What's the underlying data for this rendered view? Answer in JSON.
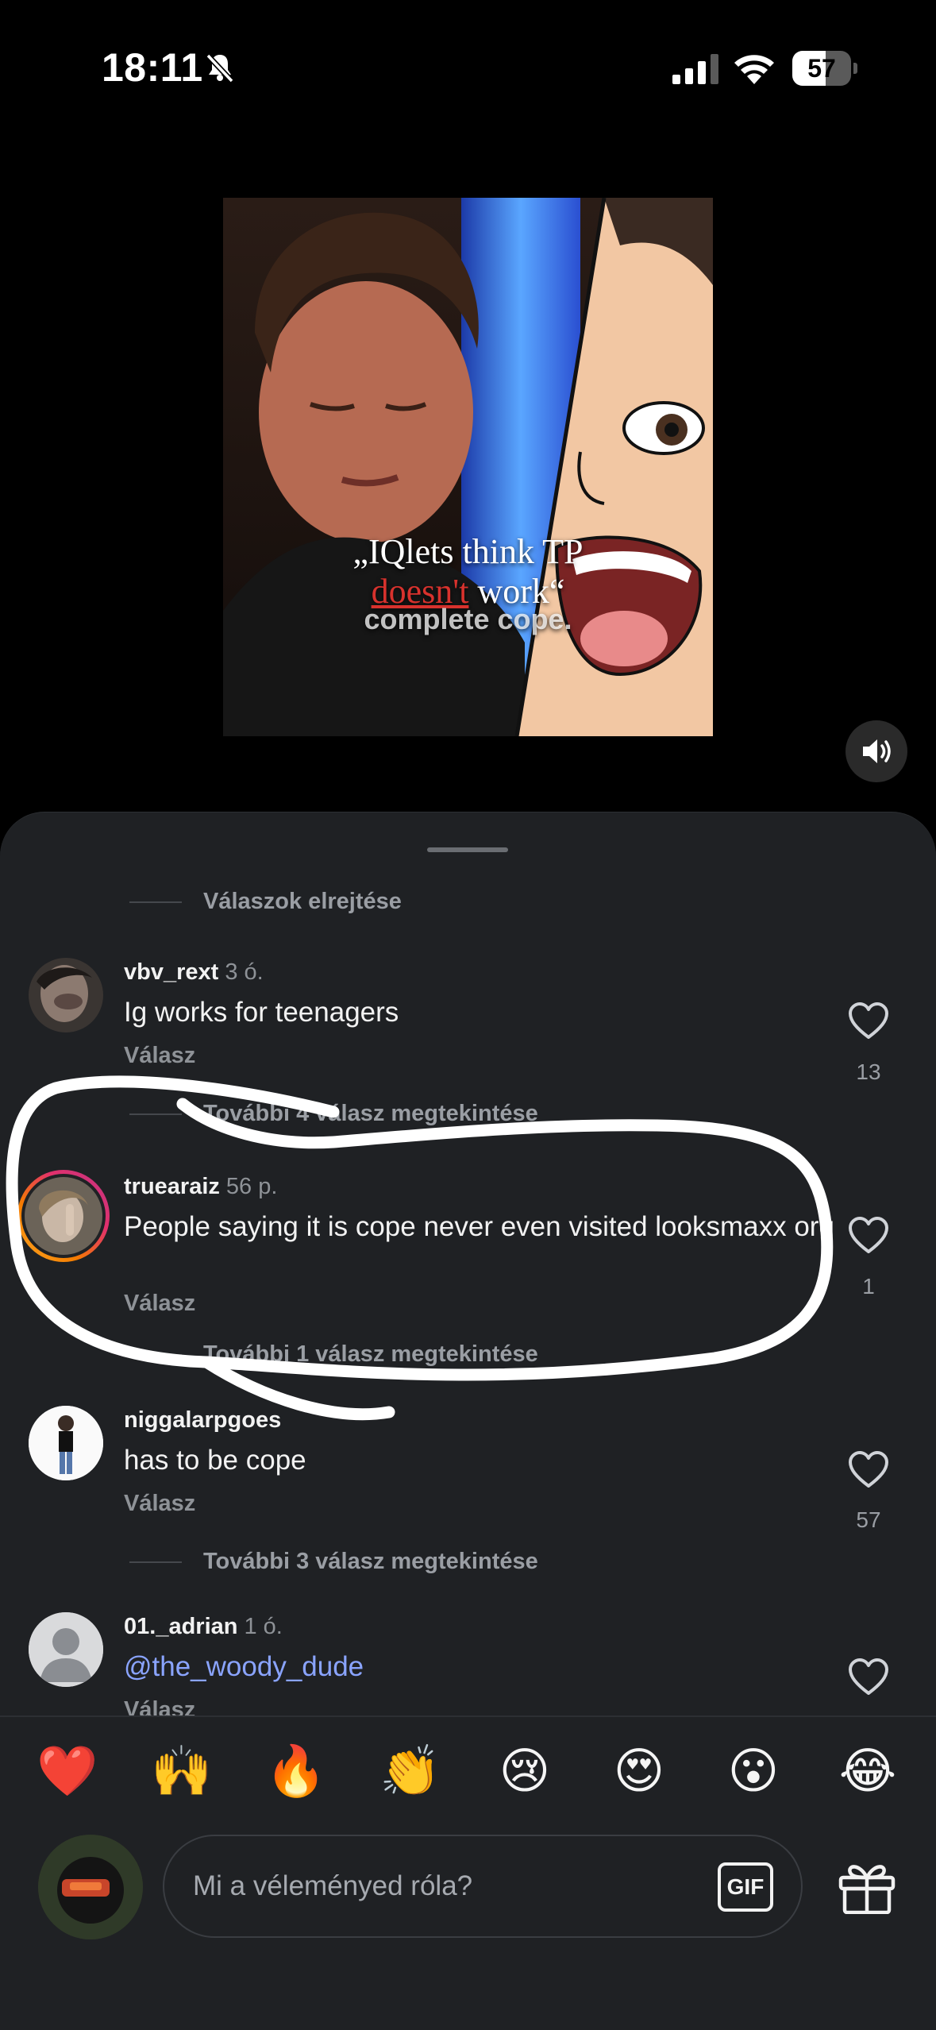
{
  "status_bar": {
    "time": "18:11",
    "battery": "57",
    "battery_level": 0.57
  },
  "video": {
    "caption_line1": "„IQlets think TP",
    "caption_line2_red": "doesn't",
    "caption_line2_rest": " work“",
    "caption_line3": "complete cope."
  },
  "comments_sheet": {
    "hide_replies": "Válaszok elrejtése",
    "reply_label": "Válasz",
    "comments": [
      {
        "username": "vbv_rext",
        "time": "3 ó.",
        "text": "Ig works for teenagers",
        "likes": "13",
        "more_replies": "További 4 válasz megtekintése"
      },
      {
        "username": "truearaiz",
        "time": "56 p.",
        "text": "People saying it is cope never even visited looksmaxx org",
        "likes": "1",
        "more_replies": "További 1 válasz megtekintése"
      },
      {
        "username": "niggalarpgoes",
        "time": "",
        "text": "has to be cope",
        "likes": "57",
        "more_replies": "További 3 válasz megtekintése"
      },
      {
        "username": "01._adrian",
        "time": "1 ó.",
        "text": "@the_woody_dude",
        "likes": ""
      }
    ]
  },
  "composer": {
    "emojis": [
      "❤️",
      "🙌",
      "🔥",
      "👏",
      "😢",
      "😍",
      "😮",
      "😂"
    ],
    "placeholder": "Mi a véleményed róla?",
    "gif_label": "GIF"
  },
  "colors": {
    "sheet_bg": "#1f2124",
    "mention": "#8aa4ff",
    "story_ring_start": "#f58529",
    "story_ring_end": "#dd2a7b"
  }
}
